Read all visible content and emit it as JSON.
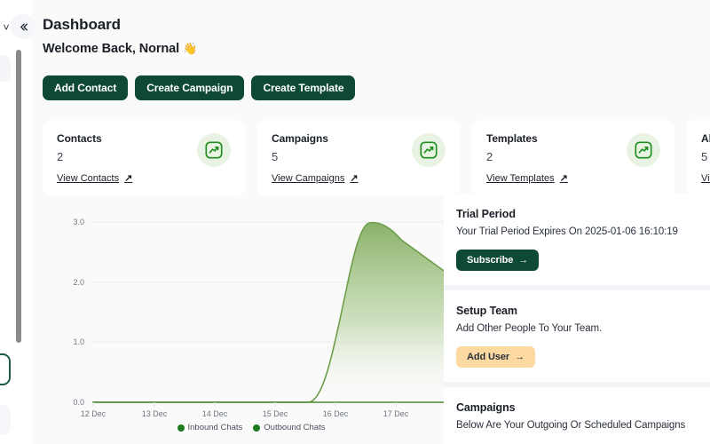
{
  "header": {
    "title": "Dashboard",
    "welcome": "Welcome Back, Nornal",
    "wave_emoji": "👋",
    "collapse_icon": "chevron-double-left-icon"
  },
  "actions": [
    {
      "label": "Add Contact",
      "name": "add-contact-button"
    },
    {
      "label": "Create Campaign",
      "name": "create-campaign-button"
    },
    {
      "label": "Create Template",
      "name": "create-template-button"
    }
  ],
  "stats": [
    {
      "label": "Contacts",
      "value": "2",
      "link": "View Contacts",
      "arrow": "↗",
      "icon": "trending-up-icon"
    },
    {
      "label": "Campaigns",
      "value": "5",
      "link": "View Campaigns",
      "arrow": "↗",
      "icon": "trending-up-icon"
    },
    {
      "label": "Templates",
      "value": "2",
      "link": "View Templates",
      "arrow": "↗",
      "icon": "trending-up-icon"
    },
    {
      "label": "All Chats",
      "value": "5",
      "link": "View Chats",
      "arrow": "",
      "icon": "trending-up-icon"
    }
  ],
  "chart_data": {
    "type": "area",
    "title": "",
    "xlabel": "",
    "ylabel": "",
    "ylim": [
      0,
      3
    ],
    "yticks": [
      "0.0",
      "1.0",
      "2.0",
      "3.0"
    ],
    "categories": [
      "12 Dec",
      "13 Dec",
      "14 Dec",
      "15 Dec",
      "16 Dec",
      "17 Dec"
    ],
    "grid": true,
    "legend_position": "bottom",
    "series": [
      {
        "name": "Inbound Chats",
        "color": "#1f7a1f",
        "values": [
          0,
          0,
          0,
          0,
          0,
          0,
          0
        ]
      },
      {
        "name": "Outbound Chats",
        "color": "#1f7a1f",
        "values": [
          0,
          0,
          0,
          0,
          0,
          3,
          2
        ]
      }
    ],
    "area_color": "#8cb86a",
    "line_color": "#6d9e4a"
  },
  "trial": {
    "title": "Trial Period",
    "text": "Your Trial Period Expires On 2025-01-06 16:10:19",
    "button": "Subscribe",
    "button_arrow": "→"
  },
  "team": {
    "title": "Setup Team",
    "text": "Add Other People To Your Team.",
    "button": "Add User",
    "button_arrow": "→"
  },
  "campaigns": {
    "title": "Campaigns",
    "text": "Below Are Your Outgoing Or Scheduled Campaigns"
  },
  "colors": {
    "brand_dark_green": "#0e4a33",
    "accent_peach": "#fcd9a0",
    "chart_green": "#6d9e4a",
    "icon_bg": "#e9f3e4"
  }
}
